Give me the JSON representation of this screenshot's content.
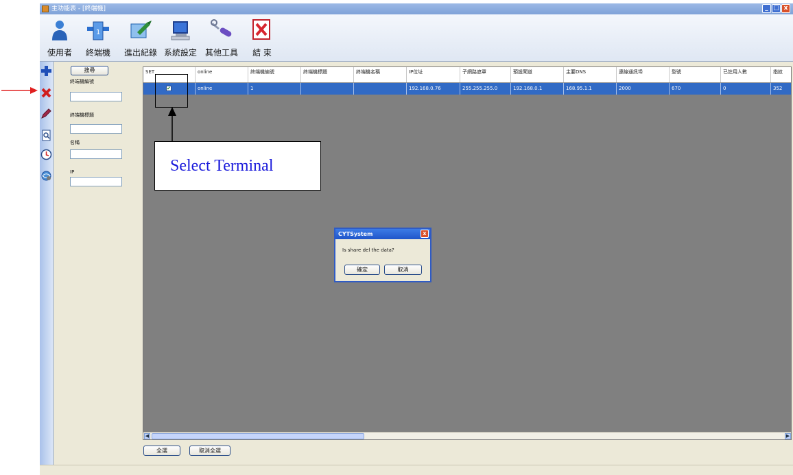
{
  "window": {
    "title": "主功能表 - [終端機]",
    "min": "_",
    "max": "□",
    "close": "x"
  },
  "toolbar": {
    "items": [
      {
        "label": "使用者",
        "icon": "user-icon"
      },
      {
        "label": "終端機",
        "icon": "terminal-icon"
      },
      {
        "label": "進出紀錄",
        "icon": "records-icon"
      },
      {
        "label": "系統設定",
        "icon": "settings-icon"
      },
      {
        "label": "其他工具",
        "icon": "tools-icon"
      },
      {
        "label": "結 束",
        "icon": "exit-icon"
      }
    ]
  },
  "leftbar": {
    "icons": [
      "add-icon",
      "delete-icon",
      "edit-icon",
      "search-doc-icon",
      "clock-icon",
      "network-icon"
    ]
  },
  "search": {
    "button": "搜尋",
    "fields": [
      {
        "label": "終端機編號",
        "value": ""
      },
      {
        "label": "終端機標題",
        "value": ""
      },
      {
        "label": "名稱",
        "value": ""
      },
      {
        "label": "IP",
        "value": ""
      }
    ]
  },
  "grid": {
    "columns": [
      "SET",
      "online",
      "終端機編號",
      "終端機標題",
      "終端機名稱",
      "IP位址",
      "子網路遮罩",
      "預設閘道",
      "主要DNS",
      "連線通訊埠",
      "型號",
      "已註用人數",
      "指紋"
    ],
    "rows": [
      {
        "set": "✔",
        "online": "online",
        "id": "1",
        "title": "",
        "name": "",
        "ip": "192.168.0.76",
        "mask": "255.255.255.0",
        "gateway": "192.168.0.1",
        "dns": "168.95.1.1",
        "port": "2000",
        "model": "670",
        "users": "0",
        "fp": "352"
      }
    ]
  },
  "dialog": {
    "title": "CYTSystem",
    "message": "Is share del the data?",
    "ok": "確定",
    "cancel": "取消",
    "close": "x"
  },
  "bottom": {
    "select_all": "全選",
    "deselect_all": "取消全選"
  },
  "annotation": {
    "label": "Select Terminal"
  },
  "colors": {
    "row_selected": "#316ac5",
    "grid_bg": "#808080",
    "annotation_text": "#1a1adb",
    "arrow_red": "#e02020"
  }
}
